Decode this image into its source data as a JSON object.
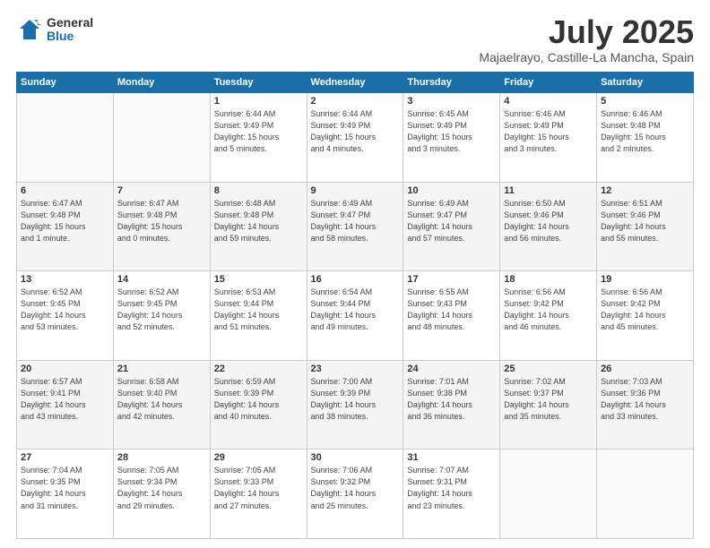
{
  "header": {
    "logo_general": "General",
    "logo_blue": "Blue",
    "month_year": "July 2025",
    "location": "Majaelrayo, Castille-La Mancha, Spain"
  },
  "days_of_week": [
    "Sunday",
    "Monday",
    "Tuesday",
    "Wednesday",
    "Thursday",
    "Friday",
    "Saturday"
  ],
  "weeks": [
    [
      {
        "day": "",
        "detail": ""
      },
      {
        "day": "",
        "detail": ""
      },
      {
        "day": "1",
        "detail": "Sunrise: 6:44 AM\nSunset: 9:49 PM\nDaylight: 15 hours\nand 5 minutes."
      },
      {
        "day": "2",
        "detail": "Sunrise: 6:44 AM\nSunset: 9:49 PM\nDaylight: 15 hours\nand 4 minutes."
      },
      {
        "day": "3",
        "detail": "Sunrise: 6:45 AM\nSunset: 9:49 PM\nDaylight: 15 hours\nand 3 minutes."
      },
      {
        "day": "4",
        "detail": "Sunrise: 6:46 AM\nSunset: 9:49 PM\nDaylight: 15 hours\nand 3 minutes."
      },
      {
        "day": "5",
        "detail": "Sunrise: 6:46 AM\nSunset: 9:48 PM\nDaylight: 15 hours\nand 2 minutes."
      }
    ],
    [
      {
        "day": "6",
        "detail": "Sunrise: 6:47 AM\nSunset: 9:48 PM\nDaylight: 15 hours\nand 1 minute."
      },
      {
        "day": "7",
        "detail": "Sunrise: 6:47 AM\nSunset: 9:48 PM\nDaylight: 15 hours\nand 0 minutes."
      },
      {
        "day": "8",
        "detail": "Sunrise: 6:48 AM\nSunset: 9:48 PM\nDaylight: 14 hours\nand 59 minutes."
      },
      {
        "day": "9",
        "detail": "Sunrise: 6:49 AM\nSunset: 9:47 PM\nDaylight: 14 hours\nand 58 minutes."
      },
      {
        "day": "10",
        "detail": "Sunrise: 6:49 AM\nSunset: 9:47 PM\nDaylight: 14 hours\nand 57 minutes."
      },
      {
        "day": "11",
        "detail": "Sunrise: 6:50 AM\nSunset: 9:46 PM\nDaylight: 14 hours\nand 56 minutes."
      },
      {
        "day": "12",
        "detail": "Sunrise: 6:51 AM\nSunset: 9:46 PM\nDaylight: 14 hours\nand 55 minutes."
      }
    ],
    [
      {
        "day": "13",
        "detail": "Sunrise: 6:52 AM\nSunset: 9:45 PM\nDaylight: 14 hours\nand 53 minutes."
      },
      {
        "day": "14",
        "detail": "Sunrise: 6:52 AM\nSunset: 9:45 PM\nDaylight: 14 hours\nand 52 minutes."
      },
      {
        "day": "15",
        "detail": "Sunrise: 6:53 AM\nSunset: 9:44 PM\nDaylight: 14 hours\nand 51 minutes."
      },
      {
        "day": "16",
        "detail": "Sunrise: 6:54 AM\nSunset: 9:44 PM\nDaylight: 14 hours\nand 49 minutes."
      },
      {
        "day": "17",
        "detail": "Sunrise: 6:55 AM\nSunset: 9:43 PM\nDaylight: 14 hours\nand 48 minutes."
      },
      {
        "day": "18",
        "detail": "Sunrise: 6:56 AM\nSunset: 9:42 PM\nDaylight: 14 hours\nand 46 minutes."
      },
      {
        "day": "19",
        "detail": "Sunrise: 6:56 AM\nSunset: 9:42 PM\nDaylight: 14 hours\nand 45 minutes."
      }
    ],
    [
      {
        "day": "20",
        "detail": "Sunrise: 6:57 AM\nSunset: 9:41 PM\nDaylight: 14 hours\nand 43 minutes."
      },
      {
        "day": "21",
        "detail": "Sunrise: 6:58 AM\nSunset: 9:40 PM\nDaylight: 14 hours\nand 42 minutes."
      },
      {
        "day": "22",
        "detail": "Sunrise: 6:59 AM\nSunset: 9:39 PM\nDaylight: 14 hours\nand 40 minutes."
      },
      {
        "day": "23",
        "detail": "Sunrise: 7:00 AM\nSunset: 9:39 PM\nDaylight: 14 hours\nand 38 minutes."
      },
      {
        "day": "24",
        "detail": "Sunrise: 7:01 AM\nSunset: 9:38 PM\nDaylight: 14 hours\nand 36 minutes."
      },
      {
        "day": "25",
        "detail": "Sunrise: 7:02 AM\nSunset: 9:37 PM\nDaylight: 14 hours\nand 35 minutes."
      },
      {
        "day": "26",
        "detail": "Sunrise: 7:03 AM\nSunset: 9:36 PM\nDaylight: 14 hours\nand 33 minutes."
      }
    ],
    [
      {
        "day": "27",
        "detail": "Sunrise: 7:04 AM\nSunset: 9:35 PM\nDaylight: 14 hours\nand 31 minutes."
      },
      {
        "day": "28",
        "detail": "Sunrise: 7:05 AM\nSunset: 9:34 PM\nDaylight: 14 hours\nand 29 minutes."
      },
      {
        "day": "29",
        "detail": "Sunrise: 7:05 AM\nSunset: 9:33 PM\nDaylight: 14 hours\nand 27 minutes."
      },
      {
        "day": "30",
        "detail": "Sunrise: 7:06 AM\nSunset: 9:32 PM\nDaylight: 14 hours\nand 25 minutes."
      },
      {
        "day": "31",
        "detail": "Sunrise: 7:07 AM\nSunset: 9:31 PM\nDaylight: 14 hours\nand 23 minutes."
      },
      {
        "day": "",
        "detail": ""
      },
      {
        "day": "",
        "detail": ""
      }
    ]
  ]
}
